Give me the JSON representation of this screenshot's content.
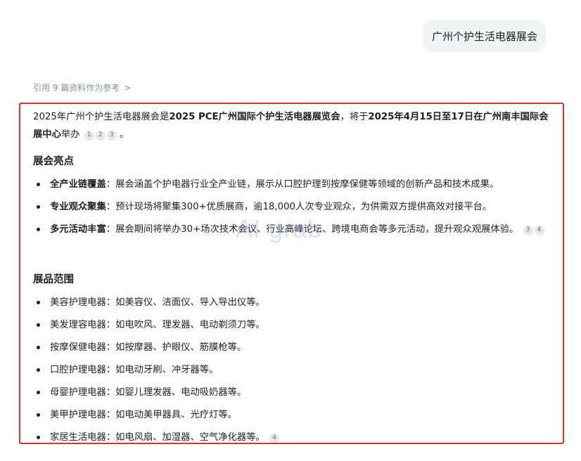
{
  "user_query": "广州个护生活电器展会",
  "references": {
    "label": "引用 9 篇资料作为参考",
    "chevron": ">"
  },
  "answer": {
    "intro": {
      "t1": "2025年广州个护生活电器展会是",
      "b1": "2025 PCE广州国际个护生活电器展览会",
      "t2": "，将于",
      "b2": "2025年4月15日至17日在广州南丰国际会展中心",
      "t3": "举办",
      "cites": [
        "1",
        "2",
        "3"
      ],
      "end": "。"
    },
    "section1": {
      "title": "展会亮点",
      "items": [
        {
          "label": "全产业链覆盖",
          "text": "：展会涵盖个护电器行业全产业链，展示从口腔护理到按摩保健等领域的创新产品和技术成果。",
          "cites": []
        },
        {
          "label": "专业观众聚集",
          "text": "：预计现场将聚集300+优质展商，逾18,000人次专业观众，为供需双方提供高效对接平台。",
          "cites": []
        },
        {
          "label": "多元活动丰富",
          "text": "：展会期间将举办30+场次技术会议、行业高峰论坛、跨境电商会等多元活动，提升观众观展体验。",
          "cites": [
            "3",
            "4"
          ]
        }
      ]
    },
    "section2": {
      "title": "展品范围",
      "items": [
        {
          "text": "美容护理电器：如美容仪、洁面仪、导入导出仪等。",
          "cites": []
        },
        {
          "text": "美发理容电器：如电吹风、理发器、电动剃须刀等。",
          "cites": []
        },
        {
          "text": "按摩保健电器：如按摩器、护眼仪、筋膜枪等。",
          "cites": []
        },
        {
          "text": "口腔护理电器：如电动牙刷、冲牙器等。",
          "cites": []
        },
        {
          "text": "母婴护理电器：如婴儿理发器、电动吸奶器等。",
          "cites": []
        },
        {
          "text": "美甲护理电器：如电动美甲器具、光疗灯等。",
          "cites": []
        },
        {
          "text": "家居生活电器：如电风扇、加湿器、空气净化器等。",
          "cites": [
            "4"
          ]
        }
      ]
    }
  },
  "watermark": "AI grab",
  "colors": {
    "highlight_border": "#e03131",
    "bubble_bg": "#f2f3f5"
  }
}
